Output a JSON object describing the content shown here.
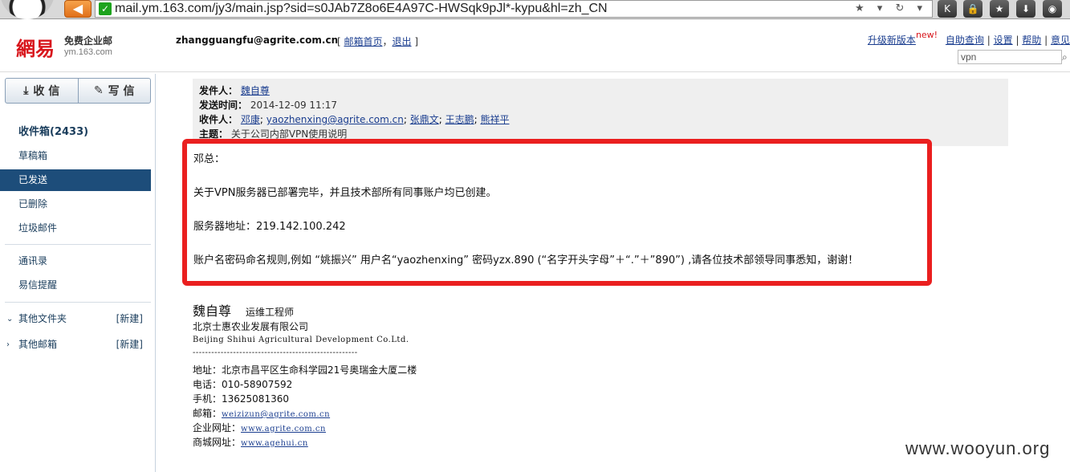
{
  "browser": {
    "url": "mail.ym.163.com/jy3/main.jsp?sid=s0JAb7Z8o6E4A97C-HWSqk9pJl*-kypu&hl=zh_CN",
    "url_tools": "★ ▾ ↻ ▾"
  },
  "header": {
    "logo": "網易",
    "logo_sub1": "免费企业邮",
    "logo_sub2": "ym.163.com",
    "user_email": "zhangguangfu@agrite.com.cn",
    "link_home": "邮箱首页",
    "link_logout": "退出",
    "upgrade": "升级新版本",
    "new_tag": "new!",
    "help_self": "自助查询",
    "settings": "设置",
    "help": "帮助",
    "feedback": "意见",
    "search_value": "vpn"
  },
  "sidebar": {
    "receive": "收 信",
    "compose": "写 信",
    "items": {
      "inbox": "收件箱(2433)",
      "drafts": "草稿箱",
      "sent": "已发送",
      "deleted": "已删除",
      "spam": "垃圾邮件",
      "contacts": "通讯录",
      "reminder": "易信提醒",
      "other_folders": "其他文件夹",
      "other_mailboxes": "其他邮箱",
      "new_label": "[新建]"
    }
  },
  "mail": {
    "from_label": "发件人：",
    "from": "魏自尊",
    "time_label": "发送时间：",
    "time": "2014-12-09 11:17",
    "to_label": "收件人：",
    "to": [
      "邓康",
      "yaozhenxing@agrite.com.cn",
      "张鼎文",
      "王志鹏",
      "熊祥平"
    ],
    "subject_label": "主题：",
    "subject": "关于公司内部VPN使用说明",
    "body": [
      "邓总：",
      "关于VPN服务器已部署完毕，并且技术部所有同事账户均已创建。",
      "服务器地址：219.142.100.242",
      "账户名密码命名规则,例如 “姚振兴” 用户名“yaozhenxing” 密码yzx.890 (“名字开头字母”＋“.”＋”890”) ,请各位技术部领导同事悉知，谢谢！"
    ],
    "signature": {
      "name": "魏自尊",
      "title": "运维工程师",
      "company": "北京士惠农业发展有限公司",
      "company_en": "Beijing Shihui Agricultural Development Co.Ltd.",
      "divider": "-----------------------------------------------------",
      "address": "地址：北京市昌平区生命科学园21号奥瑞金大厦二楼",
      "phone": "电话：010-58907592",
      "mobile": "手机：13625081360",
      "email_label": "邮箱：",
      "email": "weizizun@agrite.com.cn",
      "site_label": "企业网址：",
      "site": "www.agrite.com.cn",
      "shop_label": "商城网址：",
      "shop": "www.agehui.cn"
    }
  },
  "watermark": "www.wooyun.org"
}
